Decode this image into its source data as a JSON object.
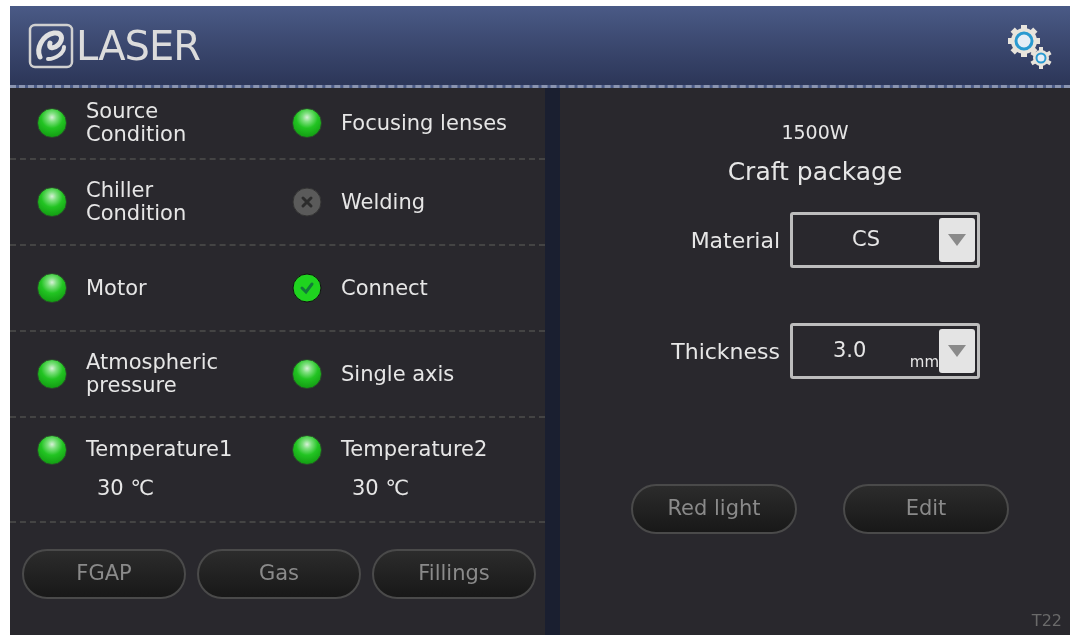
{
  "header": {
    "logo_text": "LASER"
  },
  "indicators": [
    {
      "label": "Source Condition",
      "kind": "lamp"
    },
    {
      "label": "Focusing lenses",
      "kind": "lamp"
    },
    {
      "label": "Chiller Condition",
      "kind": "lamp"
    },
    {
      "label": "Welding",
      "kind": "cross"
    },
    {
      "label": "Motor",
      "kind": "lamp"
    },
    {
      "label": "Connect",
      "kind": "check"
    },
    {
      "label": "Atmospheric pressure",
      "kind": "lamp"
    },
    {
      "label": "Single axis",
      "kind": "lamp"
    },
    {
      "label": "Temperature1",
      "kind": "lamp",
      "reading": "30 ℃"
    },
    {
      "label": "Temperature2",
      "kind": "lamp",
      "reading": "30 ℃"
    }
  ],
  "left_buttons": [
    "FGAP",
    "Gas",
    "Fillings"
  ],
  "craft": {
    "power": "1500W",
    "title": "Craft package",
    "fields": [
      {
        "label": "Material",
        "value": "CS"
      },
      {
        "label": "Thickness",
        "value": "3.0",
        "unit": "mm"
      }
    ]
  },
  "right_buttons": [
    "Red light",
    "Edit"
  ],
  "screen_code": "T22"
}
